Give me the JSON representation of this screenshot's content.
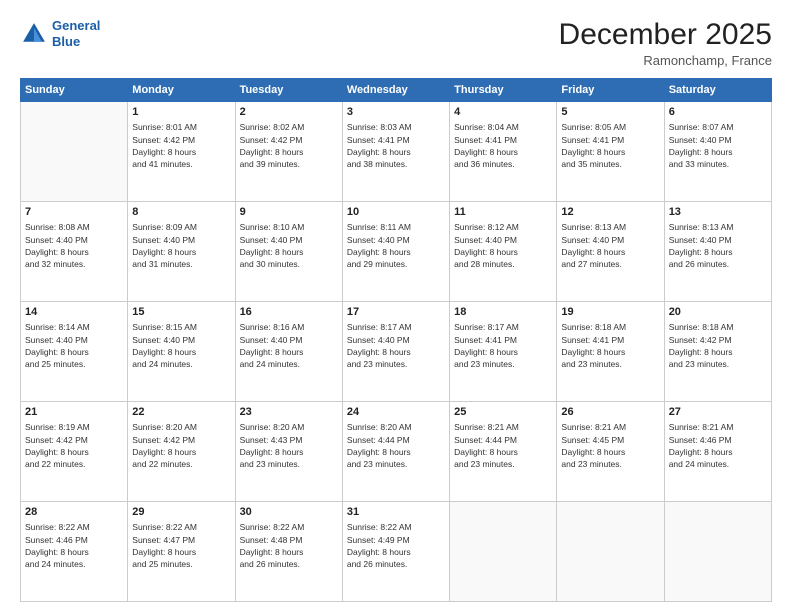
{
  "header": {
    "logo_line1": "General",
    "logo_line2": "Blue",
    "main_title": "December 2025",
    "subtitle": "Ramonchamp, France"
  },
  "columns": [
    "Sunday",
    "Monday",
    "Tuesday",
    "Wednesday",
    "Thursday",
    "Friday",
    "Saturday"
  ],
  "weeks": [
    {
      "shade": false,
      "days": [
        {
          "num": "",
          "info": ""
        },
        {
          "num": "1",
          "info": "Sunrise: 8:01 AM\nSunset: 4:42 PM\nDaylight: 8 hours\nand 41 minutes."
        },
        {
          "num": "2",
          "info": "Sunrise: 8:02 AM\nSunset: 4:42 PM\nDaylight: 8 hours\nand 39 minutes."
        },
        {
          "num": "3",
          "info": "Sunrise: 8:03 AM\nSunset: 4:41 PM\nDaylight: 8 hours\nand 38 minutes."
        },
        {
          "num": "4",
          "info": "Sunrise: 8:04 AM\nSunset: 4:41 PM\nDaylight: 8 hours\nand 36 minutes."
        },
        {
          "num": "5",
          "info": "Sunrise: 8:05 AM\nSunset: 4:41 PM\nDaylight: 8 hours\nand 35 minutes."
        },
        {
          "num": "6",
          "info": "Sunrise: 8:07 AM\nSunset: 4:40 PM\nDaylight: 8 hours\nand 33 minutes."
        }
      ]
    },
    {
      "shade": true,
      "days": [
        {
          "num": "7",
          "info": "Sunrise: 8:08 AM\nSunset: 4:40 PM\nDaylight: 8 hours\nand 32 minutes."
        },
        {
          "num": "8",
          "info": "Sunrise: 8:09 AM\nSunset: 4:40 PM\nDaylight: 8 hours\nand 31 minutes."
        },
        {
          "num": "9",
          "info": "Sunrise: 8:10 AM\nSunset: 4:40 PM\nDaylight: 8 hours\nand 30 minutes."
        },
        {
          "num": "10",
          "info": "Sunrise: 8:11 AM\nSunset: 4:40 PM\nDaylight: 8 hours\nand 29 minutes."
        },
        {
          "num": "11",
          "info": "Sunrise: 8:12 AM\nSunset: 4:40 PM\nDaylight: 8 hours\nand 28 minutes."
        },
        {
          "num": "12",
          "info": "Sunrise: 8:13 AM\nSunset: 4:40 PM\nDaylight: 8 hours\nand 27 minutes."
        },
        {
          "num": "13",
          "info": "Sunrise: 8:13 AM\nSunset: 4:40 PM\nDaylight: 8 hours\nand 26 minutes."
        }
      ]
    },
    {
      "shade": false,
      "days": [
        {
          "num": "14",
          "info": "Sunrise: 8:14 AM\nSunset: 4:40 PM\nDaylight: 8 hours\nand 25 minutes."
        },
        {
          "num": "15",
          "info": "Sunrise: 8:15 AM\nSunset: 4:40 PM\nDaylight: 8 hours\nand 24 minutes."
        },
        {
          "num": "16",
          "info": "Sunrise: 8:16 AM\nSunset: 4:40 PM\nDaylight: 8 hours\nand 24 minutes."
        },
        {
          "num": "17",
          "info": "Sunrise: 8:17 AM\nSunset: 4:40 PM\nDaylight: 8 hours\nand 23 minutes."
        },
        {
          "num": "18",
          "info": "Sunrise: 8:17 AM\nSunset: 4:41 PM\nDaylight: 8 hours\nand 23 minutes."
        },
        {
          "num": "19",
          "info": "Sunrise: 8:18 AM\nSunset: 4:41 PM\nDaylight: 8 hours\nand 23 minutes."
        },
        {
          "num": "20",
          "info": "Sunrise: 8:18 AM\nSunset: 4:42 PM\nDaylight: 8 hours\nand 23 minutes."
        }
      ]
    },
    {
      "shade": true,
      "days": [
        {
          "num": "21",
          "info": "Sunrise: 8:19 AM\nSunset: 4:42 PM\nDaylight: 8 hours\nand 22 minutes."
        },
        {
          "num": "22",
          "info": "Sunrise: 8:20 AM\nSunset: 4:42 PM\nDaylight: 8 hours\nand 22 minutes."
        },
        {
          "num": "23",
          "info": "Sunrise: 8:20 AM\nSunset: 4:43 PM\nDaylight: 8 hours\nand 23 minutes."
        },
        {
          "num": "24",
          "info": "Sunrise: 8:20 AM\nSunset: 4:44 PM\nDaylight: 8 hours\nand 23 minutes."
        },
        {
          "num": "25",
          "info": "Sunrise: 8:21 AM\nSunset: 4:44 PM\nDaylight: 8 hours\nand 23 minutes."
        },
        {
          "num": "26",
          "info": "Sunrise: 8:21 AM\nSunset: 4:45 PM\nDaylight: 8 hours\nand 23 minutes."
        },
        {
          "num": "27",
          "info": "Sunrise: 8:21 AM\nSunset: 4:46 PM\nDaylight: 8 hours\nand 24 minutes."
        }
      ]
    },
    {
      "shade": false,
      "days": [
        {
          "num": "28",
          "info": "Sunrise: 8:22 AM\nSunset: 4:46 PM\nDaylight: 8 hours\nand 24 minutes."
        },
        {
          "num": "29",
          "info": "Sunrise: 8:22 AM\nSunset: 4:47 PM\nDaylight: 8 hours\nand 25 minutes."
        },
        {
          "num": "30",
          "info": "Sunrise: 8:22 AM\nSunset: 4:48 PM\nDaylight: 8 hours\nand 26 minutes."
        },
        {
          "num": "31",
          "info": "Sunrise: 8:22 AM\nSunset: 4:49 PM\nDaylight: 8 hours\nand 26 minutes."
        },
        {
          "num": "",
          "info": ""
        },
        {
          "num": "",
          "info": ""
        },
        {
          "num": "",
          "info": ""
        }
      ]
    }
  ]
}
